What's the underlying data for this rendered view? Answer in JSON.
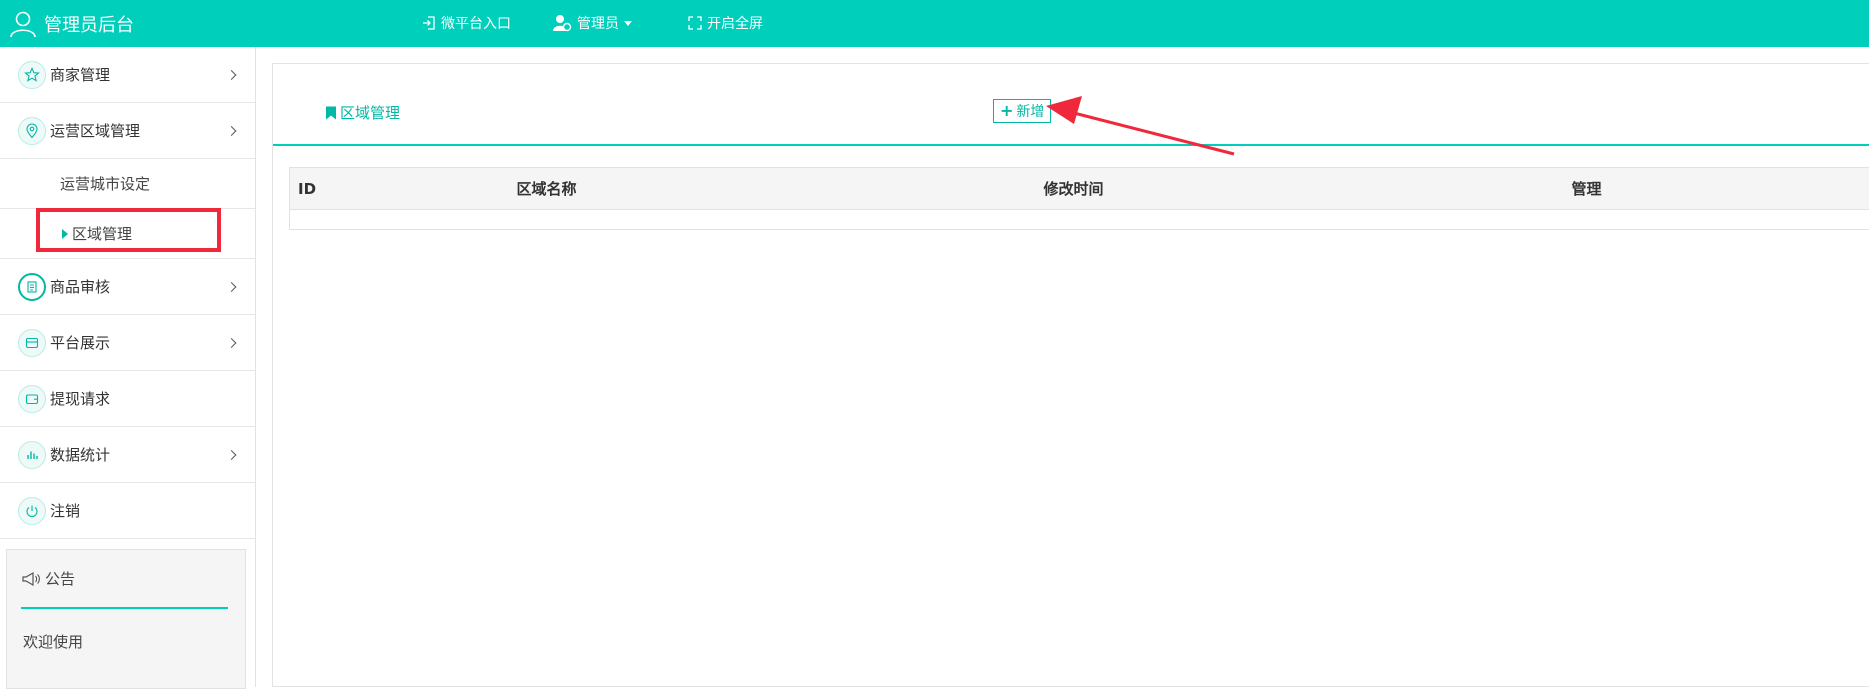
{
  "header": {
    "title": "管理员后台",
    "nav": [
      {
        "label": "微平台入口",
        "icon": "enter-icon"
      },
      {
        "label": "管理员",
        "icon": "admin-user-icon"
      },
      {
        "label": "开启全屏",
        "icon": "fullscreen-icon"
      }
    ]
  },
  "sidebar": {
    "items": [
      {
        "label": "商家管理",
        "icon": "star-icon"
      },
      {
        "label": "运营区域管理",
        "icon": "location-icon"
      },
      {
        "label": "商品审核",
        "icon": "document-icon"
      },
      {
        "label": "平台展示",
        "icon": "display-icon"
      },
      {
        "label": "提现请求",
        "icon": "wallet-icon"
      },
      {
        "label": "数据统计",
        "icon": "chart-icon"
      },
      {
        "label": "注销",
        "icon": "power-icon"
      }
    ],
    "submenu": [
      {
        "label": "运营城市设定"
      },
      {
        "label": "区域管理",
        "active": true
      }
    ],
    "notice": {
      "title": "公告",
      "text": "欢迎使用"
    }
  },
  "main": {
    "section_title": "区域管理",
    "add_label": "新增",
    "table": {
      "columns": [
        "ID",
        "区域名称",
        "修改时间",
        "管理"
      ],
      "rows": []
    }
  },
  "colors": {
    "accent": "#00cfbb",
    "highlight": "#f0283c"
  }
}
